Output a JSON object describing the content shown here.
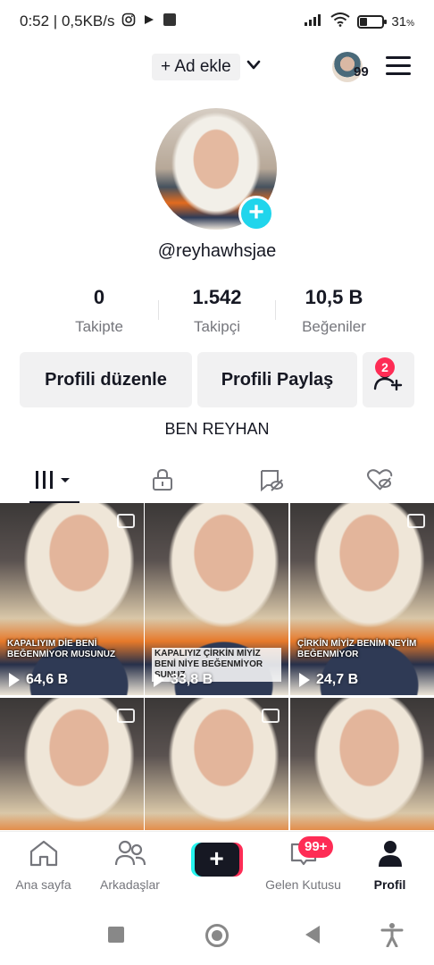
{
  "status_bar": {
    "time_speed": "0:52 | 0,5KB/s",
    "battery_pct": "31",
    "battery_unit": "%",
    "battery_level": 0.31
  },
  "header": {
    "add_account_label": "+ Ad ekle",
    "notification_count": "99"
  },
  "profile": {
    "username": "@reyhawhsjae",
    "bio": "BEN REYHAN",
    "stats": [
      {
        "value": "0",
        "label": "Takipte"
      },
      {
        "value": "1.542",
        "label": "Takipçi"
      },
      {
        "value": "10,5 B",
        "label": "Beğeniler"
      }
    ],
    "edit_button": "Profili düzenle",
    "share_button": "Profili Paylaş",
    "friend_requests_badge": "2"
  },
  "tabs": [
    {
      "icon": "videos-grid-icon"
    },
    {
      "icon": "lock-icon"
    },
    {
      "icon": "reposts-icon"
    },
    {
      "icon": "liked-hidden-icon"
    }
  ],
  "videos": [
    {
      "caption": "KAPALIYIM DİE BENİ BEĞENMİYOR MUSUNUZ",
      "views": "64,6 B"
    },
    {
      "caption": "KAPALIYIZ ÇİRKİN MİYİZ BENİ NİYE BEĞENMİYOR SUNUZ",
      "views": "33,8 B"
    },
    {
      "caption": "ÇİRKİN MİYİZ BENİM NEYİM BEĞENMİYOR",
      "views": "24,7 B"
    },
    {
      "caption": "",
      "views": ""
    },
    {
      "caption": "",
      "views": ""
    },
    {
      "caption": "",
      "views": ""
    }
  ],
  "bottom_nav": {
    "home": "Ana sayfa",
    "friends": "Arkadaşlar",
    "inbox": "Gelen Kutusu",
    "inbox_badge": "99+",
    "profile": "Profil"
  },
  "colors": {
    "accent_cyan": "#20d5ec",
    "accent_red": "#fe2c55",
    "text_primary": "#161823",
    "text_secondary": "#75767c"
  }
}
